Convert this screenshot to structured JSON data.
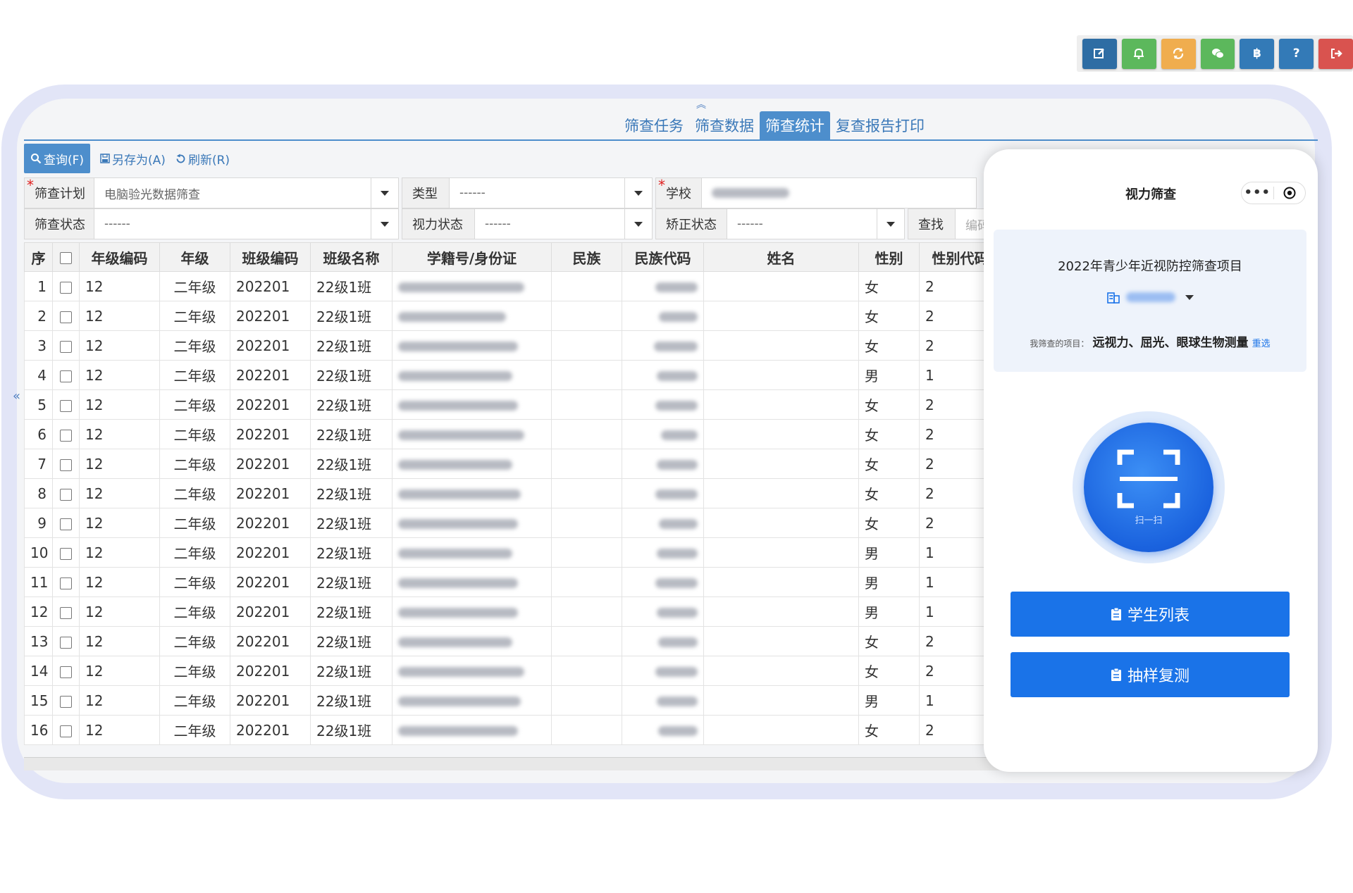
{
  "toolbar": {
    "buttons": [
      {
        "icon": "edit-icon",
        "color": "#2e6da4"
      },
      {
        "icon": "bell-icon",
        "color": "#5cb85c"
      },
      {
        "icon": "refresh-icon",
        "color": "#f0ad4e"
      },
      {
        "icon": "wechat-icon",
        "color": "#5cb85c"
      },
      {
        "icon": "bitcoin-icon",
        "color": "#337ab7"
      },
      {
        "icon": "help-icon",
        "color": "#337ab7"
      },
      {
        "icon": "logout-icon",
        "color": "#d9534f"
      }
    ]
  },
  "tabs": [
    {
      "label": "筛查任务",
      "active": false
    },
    {
      "label": "筛查数据",
      "active": false
    },
    {
      "label": "筛查统计",
      "active": true
    },
    {
      "label": "复查报告打印",
      "active": false
    }
  ],
  "query_bar": {
    "query": "查询(F)",
    "save_as": "另存为(A)",
    "refresh": "刷新(R)"
  },
  "filters": {
    "plan_label": "筛查计划",
    "plan_value": "电脑验光数据筛查",
    "type_label": "类型",
    "type_value": "------",
    "school_label": "学校",
    "status_label": "筛查状态",
    "status_value": "------",
    "vision_label": "视力状态",
    "vision_value": "------",
    "correct_label": "矫正状态",
    "correct_value": "------",
    "find_label": "查找",
    "find_placeholder": "编码"
  },
  "table": {
    "headers": [
      "序",
      "",
      "年级编码",
      "年级",
      "班级编码",
      "班级名称",
      "学籍号/身份证",
      "民族",
      "民族代码",
      "姓名",
      "性别",
      "性别代码"
    ],
    "rows": [
      {
        "seq": "1",
        "grade_code": "12",
        "grade": "二年级",
        "class_code": "202201",
        "class_name": "22级1班",
        "gender": "女",
        "gender_code": "2"
      },
      {
        "seq": "2",
        "grade_code": "12",
        "grade": "二年级",
        "class_code": "202201",
        "class_name": "22级1班",
        "gender": "女",
        "gender_code": "2"
      },
      {
        "seq": "3",
        "grade_code": "12",
        "grade": "二年级",
        "class_code": "202201",
        "class_name": "22级1班",
        "gender": "女",
        "gender_code": "2"
      },
      {
        "seq": "4",
        "grade_code": "12",
        "grade": "二年级",
        "class_code": "202201",
        "class_name": "22级1班",
        "gender": "男",
        "gender_code": "1"
      },
      {
        "seq": "5",
        "grade_code": "12",
        "grade": "二年级",
        "class_code": "202201",
        "class_name": "22级1班",
        "gender": "女",
        "gender_code": "2"
      },
      {
        "seq": "6",
        "grade_code": "12",
        "grade": "二年级",
        "class_code": "202201",
        "class_name": "22级1班",
        "gender": "女",
        "gender_code": "2"
      },
      {
        "seq": "7",
        "grade_code": "12",
        "grade": "二年级",
        "class_code": "202201",
        "class_name": "22级1班",
        "gender": "女",
        "gender_code": "2"
      },
      {
        "seq": "8",
        "grade_code": "12",
        "grade": "二年级",
        "class_code": "202201",
        "class_name": "22级1班",
        "gender": "女",
        "gender_code": "2"
      },
      {
        "seq": "9",
        "grade_code": "12",
        "grade": "二年级",
        "class_code": "202201",
        "class_name": "22级1班",
        "gender": "女",
        "gender_code": "2"
      },
      {
        "seq": "10",
        "grade_code": "12",
        "grade": "二年级",
        "class_code": "202201",
        "class_name": "22级1班",
        "gender": "男",
        "gender_code": "1"
      },
      {
        "seq": "11",
        "grade_code": "12",
        "grade": "二年级",
        "class_code": "202201",
        "class_name": "22级1班",
        "gender": "男",
        "gender_code": "1"
      },
      {
        "seq": "12",
        "grade_code": "12",
        "grade": "二年级",
        "class_code": "202201",
        "class_name": "22级1班",
        "gender": "男",
        "gender_code": "1"
      },
      {
        "seq": "13",
        "grade_code": "12",
        "grade": "二年级",
        "class_code": "202201",
        "class_name": "22级1班",
        "gender": "女",
        "gender_code": "2"
      },
      {
        "seq": "14",
        "grade_code": "12",
        "grade": "二年级",
        "class_code": "202201",
        "class_name": "22级1班",
        "gender": "女",
        "gender_code": "2"
      },
      {
        "seq": "15",
        "grade_code": "12",
        "grade": "二年级",
        "class_code": "202201",
        "class_name": "22级1班",
        "gender": "男",
        "gender_code": "1"
      },
      {
        "seq": "16",
        "grade_code": "12",
        "grade": "二年级",
        "class_code": "202201",
        "class_name": "22级1班",
        "gender": "女",
        "gender_code": "2"
      }
    ]
  },
  "phone": {
    "title": "视力筛查",
    "capsule_more": "•••",
    "project_title": "2022年青少年近视防控筛查项目",
    "items_label": "我筛查的项目：",
    "items_value": "远视力、屈光、眼球生物测量",
    "reselect": "重选",
    "scan_label": "扫一扫",
    "student_list": "学生列表",
    "sample_retest": "抽样复测",
    "accent": "#1a73e8"
  }
}
